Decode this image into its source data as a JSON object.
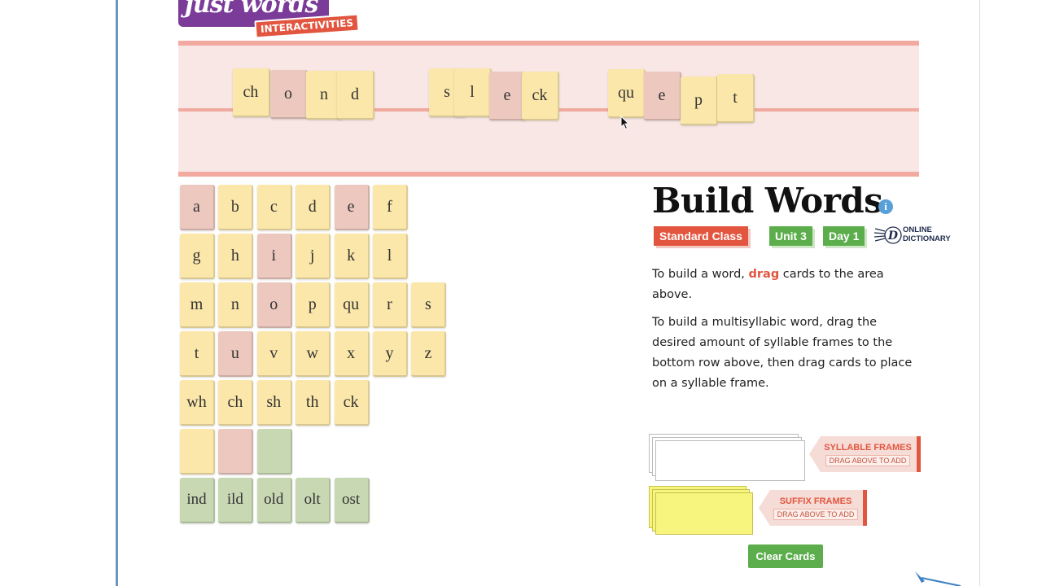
{
  "logo": {
    "wordmark": "just words",
    "tagline": "INTERACTIVITIES"
  },
  "build_area": {
    "words": [
      [
        {
          "text": "ch",
          "type": "consonant"
        },
        {
          "text": "o",
          "type": "vowel"
        },
        {
          "text": "n",
          "type": "consonant"
        },
        {
          "text": "d",
          "type": "consonant"
        }
      ],
      [
        {
          "text": "s",
          "type": "consonant"
        },
        {
          "text": "l",
          "type": "consonant"
        },
        {
          "text": "e",
          "type": "vowel"
        },
        {
          "text": "ck",
          "type": "consonant"
        }
      ],
      [
        {
          "text": "qu",
          "type": "consonant"
        },
        {
          "text": "e",
          "type": "vowel"
        },
        {
          "text": "p",
          "type": "consonant"
        },
        {
          "text": "t",
          "type": "consonant"
        }
      ]
    ]
  },
  "card_bank": {
    "rows": [
      [
        {
          "text": "a",
          "type": "vowel"
        },
        {
          "text": "b",
          "type": "consonant"
        },
        {
          "text": "c",
          "type": "consonant"
        },
        {
          "text": "d",
          "type": "consonant"
        },
        {
          "text": "e",
          "type": "vowel"
        },
        {
          "text": "f",
          "type": "consonant"
        }
      ],
      [
        {
          "text": "g",
          "type": "consonant"
        },
        {
          "text": "h",
          "type": "consonant"
        },
        {
          "text": "i",
          "type": "vowel"
        },
        {
          "text": "j",
          "type": "consonant"
        },
        {
          "text": "k",
          "type": "consonant"
        },
        {
          "text": "l",
          "type": "consonant"
        }
      ],
      [
        {
          "text": "m",
          "type": "consonant"
        },
        {
          "text": "n",
          "type": "consonant"
        },
        {
          "text": "o",
          "type": "vowel"
        },
        {
          "text": "p",
          "type": "consonant"
        },
        {
          "text": "qu",
          "type": "consonant"
        },
        {
          "text": "r",
          "type": "consonant"
        },
        {
          "text": "s",
          "type": "consonant"
        }
      ],
      [
        {
          "text": "t",
          "type": "consonant"
        },
        {
          "text": "u",
          "type": "vowel"
        },
        {
          "text": "v",
          "type": "consonant"
        },
        {
          "text": "w",
          "type": "consonant"
        },
        {
          "text": "x",
          "type": "consonant"
        },
        {
          "text": "y",
          "type": "consonant"
        },
        {
          "text": "z",
          "type": "consonant"
        }
      ],
      [
        {
          "text": "wh",
          "type": "consonant"
        },
        {
          "text": "ch",
          "type": "consonant"
        },
        {
          "text": "sh",
          "type": "consonant"
        },
        {
          "text": "th",
          "type": "consonant"
        },
        {
          "text": "ck",
          "type": "consonant"
        }
      ],
      [
        {
          "text": "",
          "type": "consonant"
        },
        {
          "text": "",
          "type": "vowel"
        },
        {
          "text": "",
          "type": "green"
        }
      ],
      [
        {
          "text": "ind",
          "type": "green"
        },
        {
          "text": "ild",
          "type": "green"
        },
        {
          "text": "old",
          "type": "green"
        },
        {
          "text": "olt",
          "type": "green"
        },
        {
          "text": "ost",
          "type": "green"
        }
      ]
    ]
  },
  "panel": {
    "title": "Build Words",
    "info_icon": "i",
    "badges": {
      "class": "Standard Class",
      "unit": "Unit 3",
      "day": "Day 1"
    },
    "dictionary": {
      "letter": "D",
      "label_line1": "ONLINE",
      "label_line2": "DICTIONARY"
    },
    "instructions": {
      "p1_before": "To build a word, ",
      "p1_drag": "drag",
      "p1_after": " cards to the area above.",
      "p2": "To build a multisyllabic word, drag the desired amount of syllable frames to the bottom row above, then drag cards to place on a syllable frame."
    },
    "syllable_frames": {
      "title": "SYLLABLE FRAMES",
      "subtitle": "DRAG ABOVE TO ADD"
    },
    "suffix_frames": {
      "title": "SUFFIX FRAMES",
      "subtitle": "DRAG ABOVE TO ADD"
    },
    "clear_button": "Clear Cards"
  },
  "colors": {
    "accent_red": "#e2553f",
    "accent_green": "#5cae4c",
    "consonant_card": "#fbe7a9",
    "vowel_card": "#ecc8bf",
    "green_card": "#c8d8b3",
    "build_area_bg": "#f8e7e5",
    "logo_purple": "#7b3b98"
  },
  "icons": [
    "info-icon",
    "dictionary-icon",
    "cursor-icon",
    "pen-icon"
  ]
}
